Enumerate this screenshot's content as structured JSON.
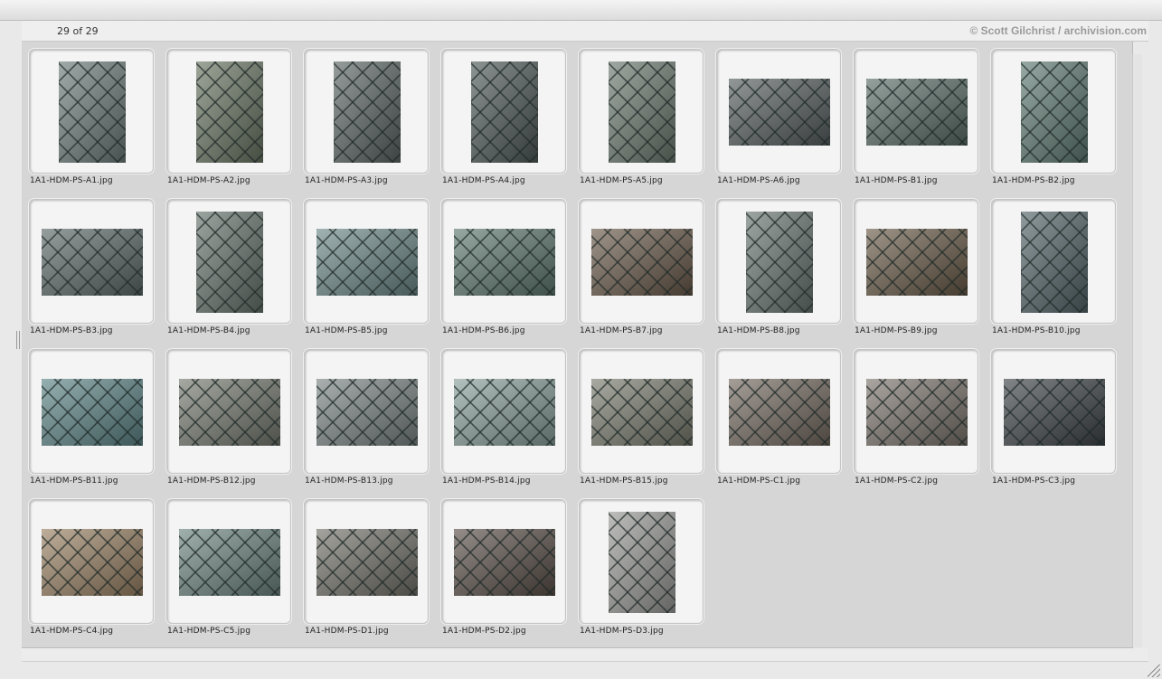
{
  "header": {
    "count": "29 of 29",
    "credit": "© Scott Gilchrist / archivision.com"
  },
  "thumbnails": [
    {
      "filename": "1A1-HDM-PS-A1.jpg",
      "orientation": "portrait",
      "tone": "#6e7d7a"
    },
    {
      "filename": "1A1-HDM-PS-A2.jpg",
      "orientation": "portrait",
      "tone": "#6a7563"
    },
    {
      "filename": "1A1-HDM-PS-A3.jpg",
      "orientation": "portrait",
      "tone": "#5c6664"
    },
    {
      "filename": "1A1-HDM-PS-A4.jpg",
      "orientation": "portrait",
      "tone": "#4f5a58"
    },
    {
      "filename": "1A1-HDM-PS-A5.jpg",
      "orientation": "portrait",
      "tone": "#6c7b70"
    },
    {
      "filename": "1A1-HDM-PS-A6.jpg",
      "orientation": "landscape",
      "tone": "#575e60"
    },
    {
      "filename": "1A1-HDM-PS-B1.jpg",
      "orientation": "landscape",
      "tone": "#5b6f68"
    },
    {
      "filename": "1A1-HDM-PS-B2.jpg",
      "orientation": "portrait",
      "tone": "#617c74"
    },
    {
      "filename": "1A1-HDM-PS-B3.jpg",
      "orientation": "landscape",
      "tone": "#5e6b69"
    },
    {
      "filename": "1A1-HDM-PS-B4.jpg",
      "orientation": "portrait",
      "tone": "#66746d"
    },
    {
      "filename": "1A1-HDM-PS-B5.jpg",
      "orientation": "landscape",
      "tone": "#6d8a88"
    },
    {
      "filename": "1A1-HDM-PS-B6.jpg",
      "orientation": "landscape",
      "tone": "#5f7a70"
    },
    {
      "filename": "1A1-HDM-PS-B7.jpg",
      "orientation": "landscape",
      "tone": "#6b5a4a"
    },
    {
      "filename": "1A1-HDM-PS-B8.jpg",
      "orientation": "portrait",
      "tone": "#6a7672"
    },
    {
      "filename": "1A1-HDM-PS-B9.jpg",
      "orientation": "landscape",
      "tone": "#6a5b48"
    },
    {
      "filename": "1A1-HDM-PS-B10.jpg",
      "orientation": "portrait",
      "tone": "#55656a"
    },
    {
      "filename": "1A1-HDM-PS-B11.jpg",
      "orientation": "landscape",
      "tone": "#5e8588"
    },
    {
      "filename": "1A1-HDM-PS-B12.jpg",
      "orientation": "landscape",
      "tone": "#767a70"
    },
    {
      "filename": "1A1-HDM-PS-B13.jpg",
      "orientation": "landscape",
      "tone": "#7b8584"
    },
    {
      "filename": "1A1-HDM-PS-B14.jpg",
      "orientation": "landscape",
      "tone": "#8aa09c"
    },
    {
      "filename": "1A1-HDM-PS-B15.jpg",
      "orientation": "landscape",
      "tone": "#7a7c6e"
    },
    {
      "filename": "1A1-HDM-PS-C1.jpg",
      "orientation": "landscape",
      "tone": "#756a60"
    },
    {
      "filename": "1A1-HDM-PS-C2.jpg",
      "orientation": "landscape",
      "tone": "#7d756d"
    },
    {
      "filename": "1A1-HDM-PS-C3.jpg",
      "orientation": "landscape",
      "tone": "#3e4448"
    },
    {
      "filename": "1A1-HDM-PS-C4.jpg",
      "orientation": "landscape",
      "tone": "#9a8264"
    },
    {
      "filename": "1A1-HDM-PS-C5.jpg",
      "orientation": "landscape",
      "tone": "#6d8580"
    },
    {
      "filename": "1A1-HDM-PS-D1.jpg",
      "orientation": "landscape",
      "tone": "#73726a"
    },
    {
      "filename": "1A1-HDM-PS-D2.jpg",
      "orientation": "landscape",
      "tone": "#5a4f48"
    },
    {
      "filename": "1A1-HDM-PS-D3.jpg",
      "orientation": "portrait",
      "tone": "#9a9a98"
    }
  ]
}
